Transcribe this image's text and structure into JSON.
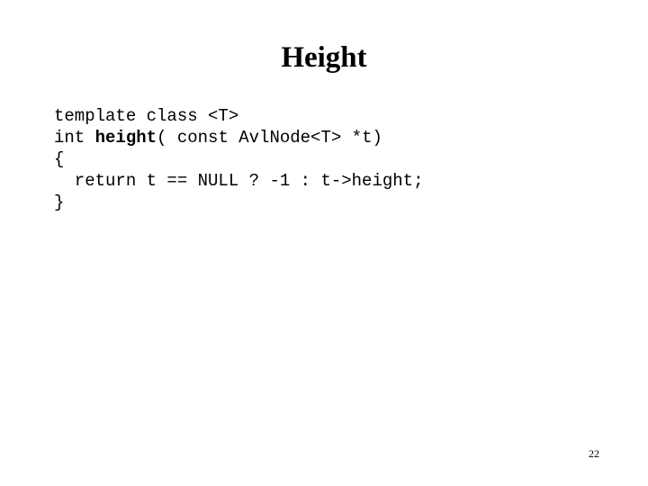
{
  "slide": {
    "title": "Height",
    "page_number": "22",
    "background_color": "#ffffff",
    "text_color": "#000000"
  },
  "code": {
    "language": "C++",
    "lines": [
      {
        "id": "line-1",
        "tokens": [
          {
            "text": "template class <T>",
            "bold": false
          }
        ]
      },
      {
        "id": "line-2",
        "tokens": [
          {
            "text": "int ",
            "bold": false
          },
          {
            "text": "height",
            "bold": true
          },
          {
            "text": "( const AvlNode<T> *t)",
            "bold": false
          }
        ]
      },
      {
        "id": "line-3",
        "tokens": [
          {
            "text": "{",
            "bold": false
          }
        ]
      },
      {
        "id": "line-4",
        "tokens": [
          {
            "text": "  return t == NULL ? -1 : t->height;",
            "bold": false
          }
        ]
      },
      {
        "id": "line-5",
        "tokens": [
          {
            "text": "}",
            "bold": false
          }
        ]
      }
    ]
  }
}
